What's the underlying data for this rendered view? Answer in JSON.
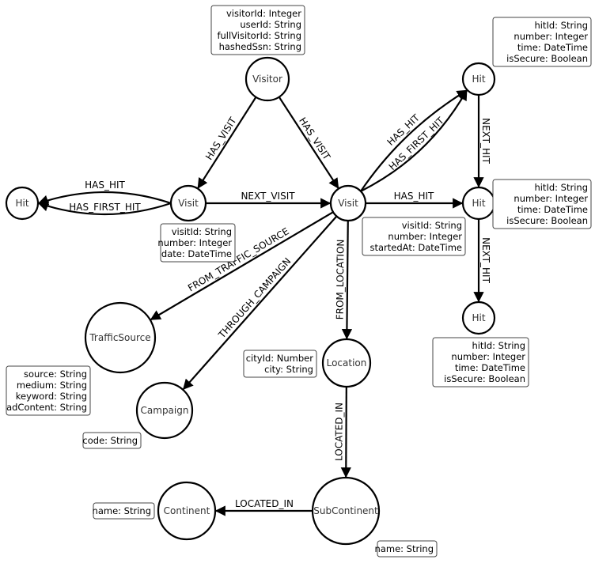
{
  "nodes": [
    {
      "id": "visitor",
      "label": "Visitor",
      "properties": [
        "visitorId: Integer",
        "userId: String",
        "fullVisitorId: String",
        "hashedSsn: String"
      ]
    },
    {
      "id": "visit1",
      "label": "Visit",
      "properties": [
        "visitId: String",
        "number: Integer",
        "date: DateTime"
      ]
    },
    {
      "id": "visit2",
      "label": "Visit",
      "properties": [
        "visitId: String",
        "number: Integer",
        "startedAt: DateTime"
      ]
    },
    {
      "id": "hitL",
      "label": "Hit",
      "properties": []
    },
    {
      "id": "hit1",
      "label": "Hit",
      "properties": [
        "hitId: String",
        "number: Integer",
        "time: DateTime",
        "isSecure: Boolean"
      ]
    },
    {
      "id": "hit2",
      "label": "Hit",
      "properties": [
        "hitId: String",
        "number: Integer",
        "time: DateTime",
        "isSecure: Boolean"
      ]
    },
    {
      "id": "hit3",
      "label": "Hit",
      "properties": [
        "hitId: String",
        "number: Integer",
        "time: DateTime",
        "isSecure: Boolean"
      ]
    },
    {
      "id": "trafficSource",
      "label": "TrafficSource",
      "properties": [
        "source: String",
        "medium: String",
        "keyword: String",
        "adContent: String"
      ]
    },
    {
      "id": "campaign",
      "label": "Campaign",
      "properties": [
        "code: String"
      ]
    },
    {
      "id": "location",
      "label": "Location",
      "properties": [
        "cityId: Number",
        "city: String"
      ]
    },
    {
      "id": "subContinent",
      "label": "SubContinent",
      "properties": [
        "name: String"
      ]
    },
    {
      "id": "continent",
      "label": "Continent",
      "properties": [
        "name: String"
      ]
    }
  ],
  "edges": [
    {
      "from": "visitor",
      "to": "visit1",
      "label": "HAS_VISIT"
    },
    {
      "from": "visitor",
      "to": "visit2",
      "label": "HAS_VISIT"
    },
    {
      "from": "visit1",
      "to": "visit2",
      "label": "NEXT_VISIT"
    },
    {
      "from": "visit1",
      "to": "hitL",
      "label": "HAS_FIRST_HIT"
    },
    {
      "from": "visit1",
      "to": "hitL",
      "label": "HAS_HIT"
    },
    {
      "from": "visit2",
      "to": "hit1",
      "label": "HAS_HIT"
    },
    {
      "from": "visit2",
      "to": "hit1",
      "label": "HAS_FIRST_HIT"
    },
    {
      "from": "visit2",
      "to": "hit2",
      "label": "HAS_HIT"
    },
    {
      "from": "hit1",
      "to": "hit2",
      "label": "NEXT_HIT"
    },
    {
      "from": "hit2",
      "to": "hit3",
      "label": "NEXT_HIT"
    },
    {
      "from": "visit2",
      "to": "trafficSource",
      "label": "FROM_TRAFFIC_SOURCE"
    },
    {
      "from": "visit2",
      "to": "campaign",
      "label": "THROUGH_CAMPAIGN"
    },
    {
      "from": "visit2",
      "to": "location",
      "label": "FROM_LOCATION"
    },
    {
      "from": "location",
      "to": "subContinent",
      "label": "LOCATED_IN"
    },
    {
      "from": "subContinent",
      "to": "continent",
      "label": "LOCATED_IN"
    }
  ]
}
